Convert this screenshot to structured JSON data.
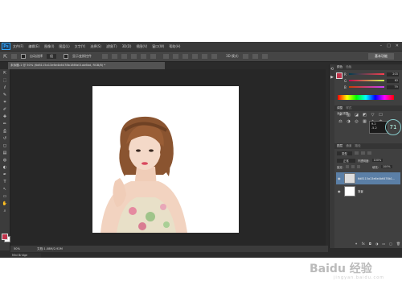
{
  "app": {
    "logo": "Ps"
  },
  "menubar": {
    "items": [
      "文件(F)",
      "编辑(E)",
      "图像(I)",
      "图层(L)",
      "文字(Y)",
      "选择(S)",
      "滤镜(T)",
      "3D(D)",
      "视图(V)",
      "窗口(W)",
      "帮助(H)"
    ],
    "controls": [
      "–",
      "□",
      "✕"
    ]
  },
  "options_bar": {
    "auto_select_label": "自动选择",
    "auto_select_value": "组",
    "show_transform_label": "显示变换控件",
    "mode_3d_label": "3D 模式:",
    "workspace": "基本功能"
  },
  "document": {
    "tab_title": "未标题-1 @ 50% (6d8115a13e6e4b6478b186fa01ab6bd, RGB/8) *",
    "zoom": "50%",
    "doc_size": "文档:1.08M/2.92M"
  },
  "bottom": {
    "mini_bridge": "Mini Bridge"
  },
  "tools": [
    "move-tool",
    "marquee-tool",
    "lasso-tool",
    "quick-select-tool",
    "crop-tool",
    "eyedropper-tool",
    "healing-tool",
    "brush-tool",
    "clone-stamp-tool",
    "history-brush-tool",
    "eraser-tool",
    "gradient-tool",
    "blur-tool",
    "dodge-tool",
    "pen-tool",
    "type-tool",
    "path-select-tool",
    "shape-tool",
    "hand-tool",
    "zoom-tool"
  ],
  "tool_glyphs": [
    "⇱",
    "⬚",
    "ℓ",
    "✎",
    "⌗",
    "✐",
    "✚",
    "✏",
    "⎙",
    "↺",
    "◻",
    "▤",
    "◍",
    "◐",
    "✒",
    "T",
    "↖",
    "▭",
    "✋",
    "⌕"
  ],
  "colors": {
    "foreground": "#c0334b",
    "background": "#ffffff",
    "panel_tabs": [
      "颜色",
      "色板"
    ],
    "r": "203",
    "g": "62",
    "b": "79",
    "r_label": "R",
    "g_label": "G",
    "b_label": "B"
  },
  "adjustments": {
    "tabs": [
      "调整",
      "样式"
    ],
    "add_label": "添加调整",
    "icons": [
      "☀",
      "▥",
      "◪",
      "◩",
      "▽",
      "☐",
      "⚖",
      "◑",
      "◎",
      "▦",
      "◈",
      "◉"
    ]
  },
  "layers": {
    "tabs": [
      "图层",
      "通道",
      "路径"
    ],
    "kind_label": "类型",
    "blend_mode": "正常",
    "opacity_label": "不透明度:",
    "opacity": "100%",
    "lock_label": "锁定:",
    "fill_label": "填充:",
    "fill": "100%",
    "items": [
      {
        "name": "6d8115a13e6e4b6478b1...",
        "selected": true
      },
      {
        "name": "背景",
        "selected": false
      }
    ]
  },
  "tooltip": {
    "lines": [
      "9.2",
      ".5.2"
    ],
    "badge": "71"
  },
  "watermark": {
    "brand": "Baidu 经验",
    "url": "jingyan.baidu.com"
  }
}
